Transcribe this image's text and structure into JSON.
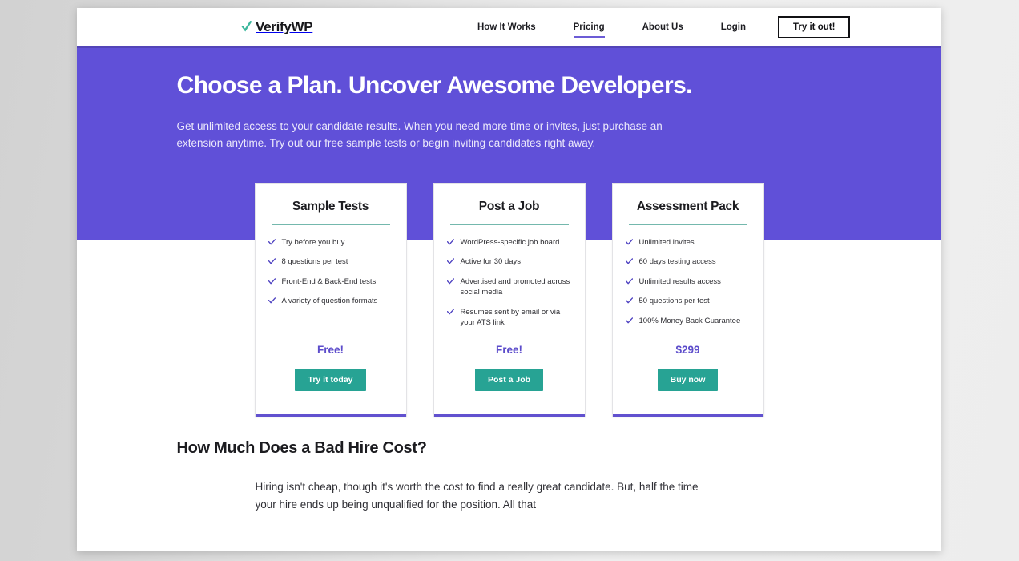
{
  "header": {
    "brand": {
      "name": "VerifyWP",
      "icon": "check-icon",
      "check_color": "#3bb79c"
    },
    "nav": [
      {
        "label": "How It Works",
        "active": false
      },
      {
        "label": "Pricing",
        "active": true
      },
      {
        "label": "About Us",
        "active": false
      },
      {
        "label": "Login",
        "active": false
      }
    ],
    "cta_label": "Try it out!"
  },
  "hero": {
    "title": "Choose a Plan. Uncover Awesome Developers.",
    "subtitle": "Get unlimited access to your candidate results. When you need more time or invites, just purchase an extension anytime. Try out our free sample tests or begin inviting candidates right away.",
    "background": "#6050d8"
  },
  "pricing": {
    "cards": [
      {
        "title": "Sample Tests",
        "features": [
          "Try before you buy",
          "8 questions per test",
          "Front-End & Back-End tests",
          "A variety of question formats"
        ],
        "price": "Free!",
        "cta_label": "Try it today"
      },
      {
        "title": "Post a Job",
        "features": [
          "WordPress-specific job board",
          "Active for 30 days",
          "Advertised and promoted across social media",
          "Resumes sent by email or via your ATS link"
        ],
        "price": "Free!",
        "cta_label": "Post a Job"
      },
      {
        "title": "Assessment Pack",
        "features": [
          "Unlimited invites",
          "60 days testing access",
          "Unlimited results access",
          "50 questions per test",
          "100% Money Back Guarantee"
        ],
        "price": "$299",
        "cta_label": "Buy now"
      }
    ],
    "accent_color": "#6151cf",
    "button_color": "#27a394",
    "price_color": "#5c4ccb",
    "check_color": "#4b3fc0",
    "rule_color": "#74b8ad"
  },
  "content": {
    "title": "How Much Does a Bad Hire Cost?",
    "paragraph": "Hiring isn't cheap, though it's worth the cost to find a really great candidate. But, half the time your hire ends up being unqualified for the position. All that"
  }
}
